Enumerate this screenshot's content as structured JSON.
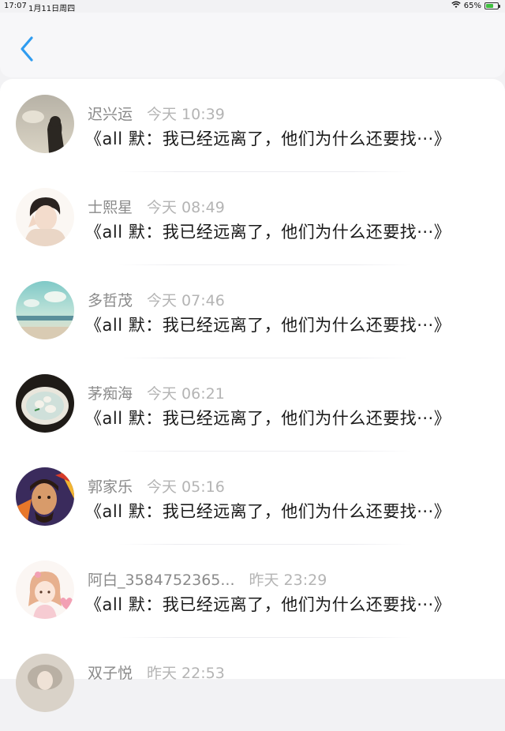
{
  "status_bar": {
    "time": "17:07",
    "date": "1月11日周四",
    "battery": "65%",
    "battery_level": 0.65
  },
  "header": {
    "back_icon": "chevron-left-icon"
  },
  "colors": {
    "accent": "#2f9cf0",
    "name_gray": "#8a8a8a",
    "time_gray": "#b4b4b4"
  },
  "messages": [
    {
      "name": "迟兴运",
      "time": "今天 10:39",
      "text": "《all 默：我已经远离了，他们为什么还要找···》"
    },
    {
      "name": "士熙星",
      "time": "今天 08:49",
      "text": "《all 默：我已经远离了，他们为什么还要找···》"
    },
    {
      "name": "多哲茂",
      "time": "今天 07:46",
      "text": "《all 默：我已经远离了，他们为什么还要找···》"
    },
    {
      "name": "茅痴海",
      "time": "今天 06:21",
      "text": "《all 默：我已经远离了，他们为什么还要找···》"
    },
    {
      "name": "郭家乐",
      "time": "今天 05:16",
      "text": "《all 默：我已经远离了，他们为什么还要找···》"
    },
    {
      "name": "阿白_3584752365...",
      "time": "昨天 23:29",
      "text": "《all 默：我已经远离了，他们为什么还要找···》"
    },
    {
      "name": "双子悦",
      "time": "昨天 22:53",
      "text": ""
    }
  ]
}
